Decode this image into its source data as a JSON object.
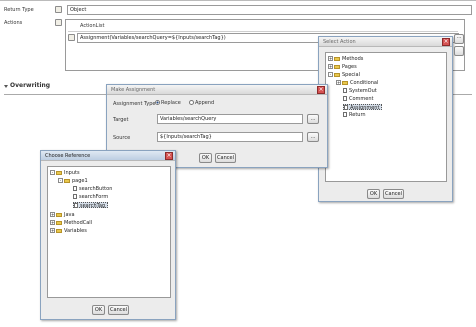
{
  "form": {
    "return_type_label": "Return Type",
    "return_type_value": "Object",
    "actions_label": "Actions",
    "action_list_header": "ActionList",
    "action_row": "Assignment(Variables/searchQuery=${Inputs/searchTag})",
    "section_title": "Overwriting"
  },
  "select_action": {
    "title": "Select Action",
    "tree": [
      {
        "label": "Methods",
        "expander": "+"
      },
      {
        "label": "Pages",
        "expander": "+"
      },
      {
        "label": "Special",
        "expander": "-"
      },
      {
        "label": "Conditional",
        "expander": "+"
      },
      {
        "label": "SystemOut"
      },
      {
        "label": "Comment"
      },
      {
        "label": "Assignment",
        "selected": true
      },
      {
        "label": "Return"
      }
    ],
    "ok": "OK",
    "cancel": "Cancel"
  },
  "make_assignment": {
    "title": "Make Assignment",
    "type_label": "Assignment Type",
    "replace": "Replace",
    "append": "Append",
    "target_label": "Target",
    "target_value": "Variables/searchQuery",
    "source_label": "Source",
    "source_value": "${Inputs/searchTag}",
    "browse": "...",
    "ok": "OK",
    "cancel": "Cancel"
  },
  "choose_reference": {
    "title": "Choose Reference",
    "tree": [
      {
        "label": "Inputs",
        "expander": "-"
      },
      {
        "label": "page1",
        "expander": "-"
      },
      {
        "label": "searchButton"
      },
      {
        "label": "searchForm"
      },
      {
        "label": "searchTag",
        "selected": true
      },
      {
        "label": "Java",
        "expander": "+"
      },
      {
        "label": "MethodCall",
        "expander": "+"
      },
      {
        "label": "Variables",
        "expander": "+"
      }
    ],
    "ok": "OK",
    "cancel": "Cancel"
  },
  "icons": {
    "collapse": "triangle-down",
    "folder": "folder-icon",
    "leaf": "document-icon",
    "close": "close-icon"
  },
  "colors": {
    "close": "#d65252",
    "title_active": "#bccde2",
    "folder": "#e9c84c",
    "selection": "#d6dfea"
  }
}
